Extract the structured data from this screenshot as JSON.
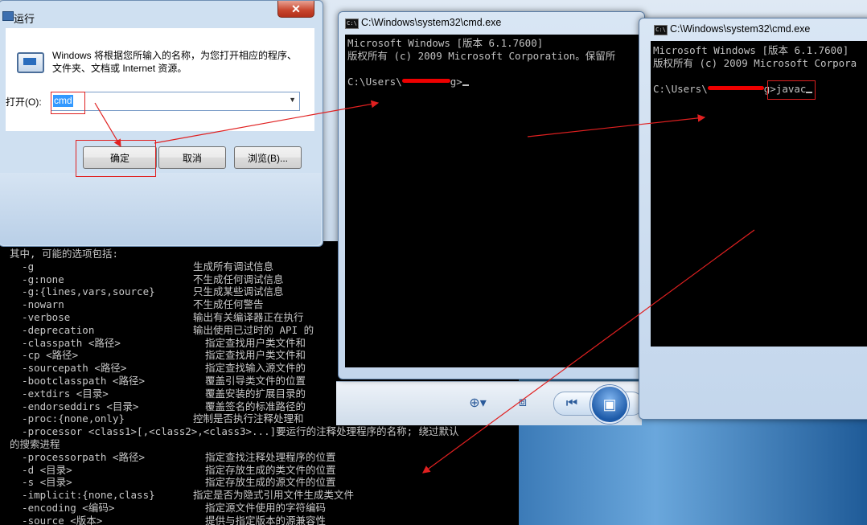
{
  "run_dialog": {
    "title": "运行",
    "description": "Windows 将根据您所输入的名称，为您打开相应的程序、文件夹、文档或 Internet 资源。",
    "open_label": "打开(O):",
    "open_value": "cmd",
    "ok_label": "确定",
    "cancel_label": "取消",
    "browse_label": "浏览(B)...",
    "close_glyph": "✕"
  },
  "cmd_window_1": {
    "title": "C:\\Windows\\system32\\cmd.exe",
    "lines": [
      "Microsoft Windows [版本 6.1.7600]",
      "版权所有 (c) 2009 Microsoft Corporation。保留所",
      "",
      "C:\\Users\\"
    ],
    "prompt_tail": "g>"
  },
  "cmd_window_2": {
    "title": "C:\\Windows\\system32\\cmd.exe",
    "lines": [
      "Microsoft Windows [版本 6.1.7600]",
      "版权所有 (c) 2009 Microsoft Corpora",
      "",
      "C:\\Users\\"
    ],
    "prompt_tail": "g>",
    "typed_command": "javac"
  },
  "help_console": {
    "intro": "其中, 可能的选项包括:",
    "options": [
      {
        "opt": "  -g",
        "desc": "生成所有调试信息"
      },
      {
        "opt": "  -g:none",
        "desc": "不生成任何调试信息"
      },
      {
        "opt": "  -g:{lines,vars,source}",
        "desc": "只生成某些调试信息"
      },
      {
        "opt": "  -nowarn",
        "desc": "不生成任何警告"
      },
      {
        "opt": "  -verbose",
        "desc": "输出有关编译器正在执行"
      },
      {
        "opt": "  -deprecation",
        "desc": "输出使用已过时的 API 的"
      },
      {
        "opt": "  -classpath <路径>",
        "desc": "  指定查找用户类文件和"
      },
      {
        "opt": "  -cp <路径>",
        "desc": "  指定查找用户类文件和"
      },
      {
        "opt": "  -sourcepath <路径>",
        "desc": "  指定查找输入源文件的"
      },
      {
        "opt": "  -bootclasspath <路径>",
        "desc": "  覆盖引导类文件的位置"
      },
      {
        "opt": "  -extdirs <目录>",
        "desc": "  覆盖安装的扩展目录的"
      },
      {
        "opt": "  -endorseddirs <目录>",
        "desc": "  覆盖签名的标准路径的"
      },
      {
        "opt": "  -proc:{none,only}",
        "desc": "控制是否执行注释处理和"
      },
      {
        "opt": "  -processor <class1>[,<class2>,<class3>...]要运行的注释处理程序的名称; 绕过默认",
        "desc": ""
      },
      {
        "opt": "的搜索进程",
        "desc": ""
      },
      {
        "opt": "  -processorpath <路径>",
        "desc": "  指定查找注释处理程序的位置"
      },
      {
        "opt": "  -d <目录>",
        "desc": "  指定存放生成的类文件的位置"
      },
      {
        "opt": "  -s <目录>",
        "desc": "  指定存放生成的源文件的位置"
      },
      {
        "opt": "  -implicit:{none,class}",
        "desc": "指定是否为隐式引用文件生成类文件"
      },
      {
        "opt": "  -encoding <编码>",
        "desc": "  指定源文件使用的字符编码"
      },
      {
        "opt": "  -source <版本>",
        "desc": "  提供与指定版本的源兼容性"
      }
    ]
  },
  "viewer_toolbar": {
    "zoom_icon": "zoom-icon",
    "fit_icon": "fit-window-icon",
    "prev_icon": "previous-icon",
    "slideshow_icon": "slideshow-icon",
    "next_icon": "next-icon",
    "rotate_left_icon": "rotate-ccw-icon",
    "rotate_right_icon": "rotate-cw-icon",
    "delete_icon": "delete-icon"
  },
  "colors": {
    "annotation_red": "#e02020",
    "console_bg": "#000000",
    "console_text": "#c0c0c0",
    "selection_blue": "#3399ff"
  }
}
